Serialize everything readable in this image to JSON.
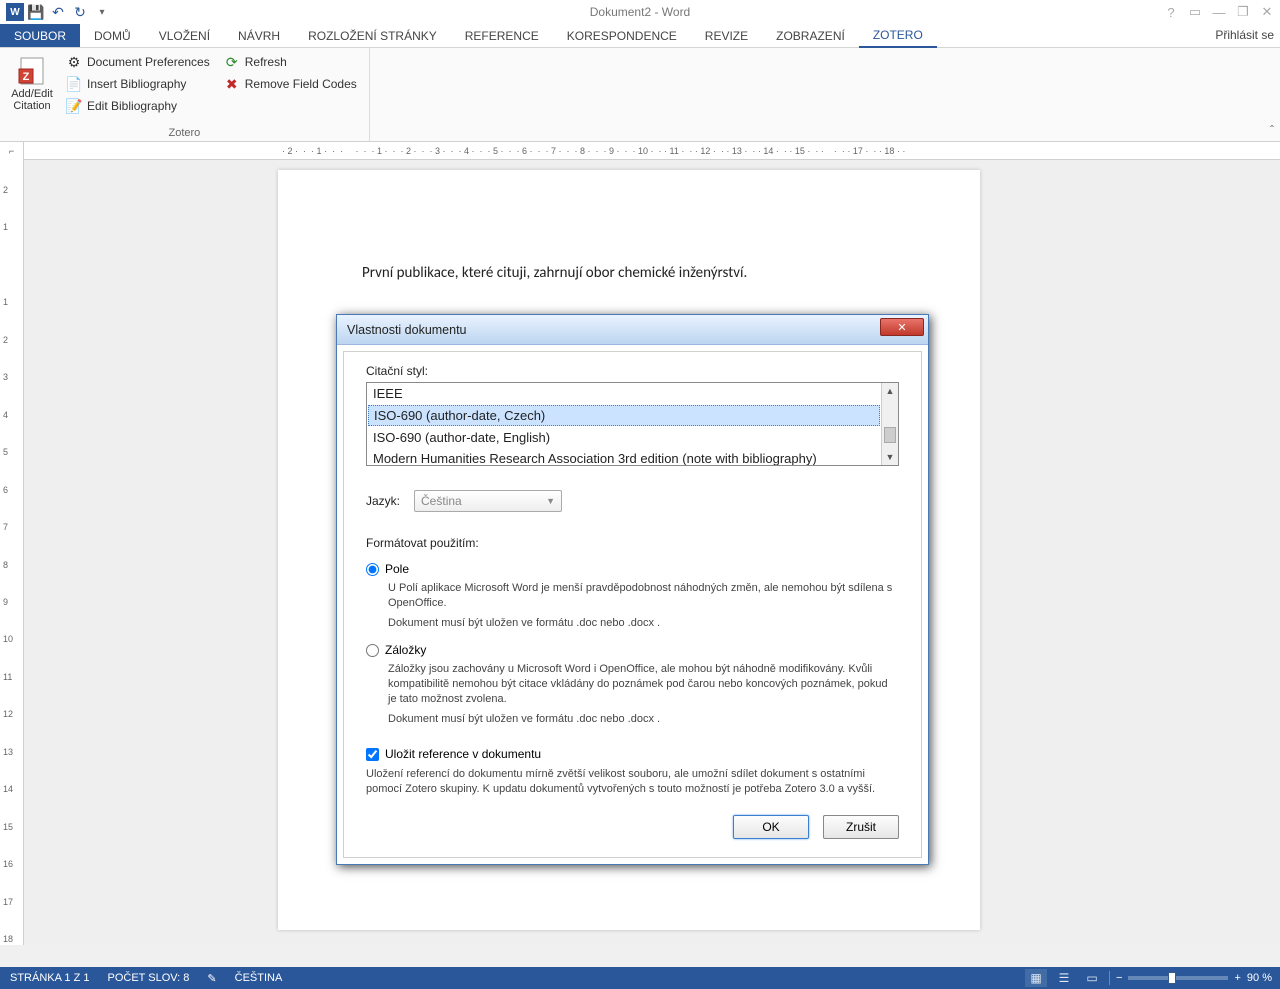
{
  "title": "Dokument2 - Word",
  "sign_in": "Přihlásit se",
  "tabs": {
    "file": "SOUBOR",
    "home": "DOMŮ",
    "insert": "VLOŽENÍ",
    "design": "NÁVRH",
    "layout": "ROZLOŽENÍ STRÁNKY",
    "references": "REFERENCE",
    "mailings": "KORESPONDENCE",
    "review": "REVIZE",
    "view": "ZOBRAZENÍ",
    "zotero": "ZOTERO"
  },
  "ribbon": {
    "big_button": "Add/Edit Citation",
    "doc_prefs": "Document Preferences",
    "insert_bib": "Insert Bibliography",
    "edit_bib": "Edit Bibliography",
    "refresh": "Refresh",
    "remove_codes": "Remove Field Codes",
    "group_label": "Zotero"
  },
  "ruler_h_marks": "· 2 ·  ·  · 1 ·  ·  ·     ·  ·  · 1 ·  ·  · 2 ·  ·  · 3 ·  ·  · 4 ·  ·  · 5 ·  ·  · 6 ·  ·  · 7 ·  ·  · 8 ·  ·  · 9 ·  ·  · 10 ·  · · 11 ·  · · 12 ·  · · 13 ·  · · 14 ·  · · 15 ·  · ·    ·  · · 17 ·  · · 18 · ·",
  "ruler_corner": "⌐",
  "doc_text": "První publikace, které cituji, zahrnují obor chemické inženýrství.",
  "dialog": {
    "title": "Vlastnosti dokumentu",
    "style_label": "Citační styl:",
    "styles": [
      "IEEE",
      "ISO-690 (author-date, Czech)",
      "ISO-690 (author-date, English)",
      "Modern Humanities Research Association 3rd edition (note with bibliography)"
    ],
    "selected_style_index": 1,
    "lang_label": "Jazyk:",
    "lang_value": "Čeština",
    "format_label": "Formátovat použitím:",
    "radio_fields": "Pole",
    "fields_desc1": "U Polí aplikace Microsoft Word je menší pravděpodobnost náhodných změn, ale nemohou být sdílena s OpenOffice.",
    "fields_desc2": "Dokument musí být uložen ve formátu .doc nebo .docx .",
    "radio_bookmarks": "Záložky",
    "bookmarks_desc1": "Záložky jsou zachovány u Microsoft Word i OpenOffice, ale mohou být náhodně modifikovány. Kvůli kompatibilitě nemohou být citace vkládány do poznámek pod čarou nebo koncových poznámek, pokud je tato možnost zvolena.",
    "bookmarks_desc2": "Dokument musí být uložen ve formátu .doc nebo .docx .",
    "store_refs": "Uložit reference v dokumentu",
    "store_desc": "Uložení referencí do dokumentu mírně zvětší velikost souboru, ale umožní sdílet dokument s ostatními pomocí Zotero skupiny. K updatu dokumentů vytvořených s touto možností je potřeba Zotero 3.0 a vyšší.",
    "ok": "OK",
    "cancel": "Zrušit"
  },
  "status": {
    "page": "STRÁNKA 1 Z 1",
    "words": "POČET SLOV: 8",
    "lang": "ČEŠTINA",
    "zoom": "90 %"
  }
}
